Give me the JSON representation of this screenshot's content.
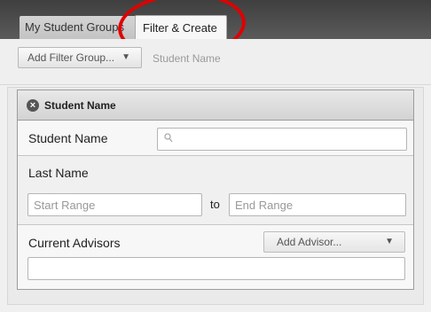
{
  "tabs": {
    "groups_label": "My Student Groups",
    "filter_label": "Filter & Create"
  },
  "toolbar": {
    "add_filter_label": "Add Filter Group...",
    "dropdown_arrow": "▼",
    "crumb": "Student Name"
  },
  "panel": {
    "title": "Student Name",
    "close_glyph": "×",
    "student_name_label": "Student Name",
    "search_value": "",
    "last_name_label": "Last Name",
    "start_placeholder": "Start Range",
    "to_label": "to",
    "end_placeholder": "End Range",
    "advisors_label": "Current Advisors",
    "add_advisor_label": "Add Advisor...",
    "advisor_value": ""
  },
  "colors": {
    "annotation_circle": "#e00000",
    "tabbar": "#4a4a4a"
  }
}
